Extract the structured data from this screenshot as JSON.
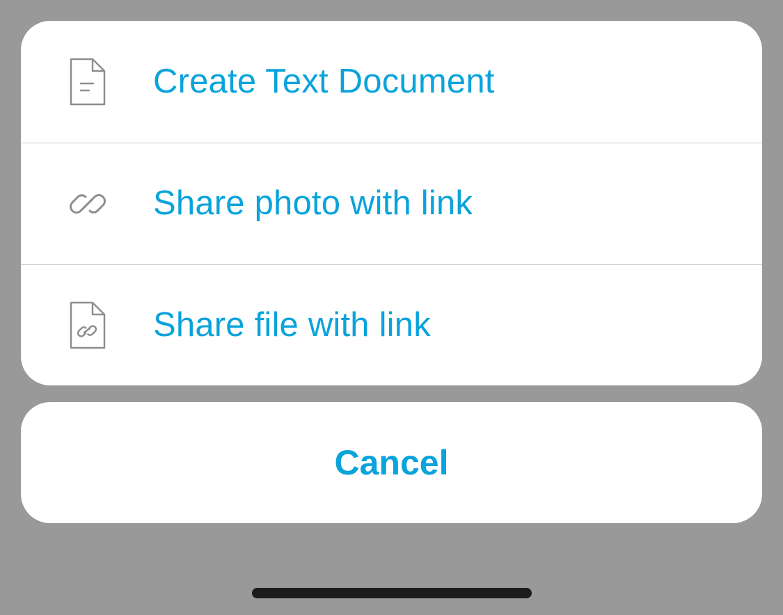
{
  "colors": {
    "accent": "#0aa3db",
    "backdrop": "#999999",
    "icon": "#8e8e8e",
    "sheet": "#ffffff"
  },
  "action_sheet": {
    "items": [
      {
        "label": "Create Text Document",
        "icon": "text-document-icon"
      },
      {
        "label": "Share photo with link",
        "icon": "link-icon"
      },
      {
        "label": "Share file with link",
        "icon": "file-link-icon"
      }
    ]
  },
  "cancel": {
    "label": "Cancel"
  }
}
